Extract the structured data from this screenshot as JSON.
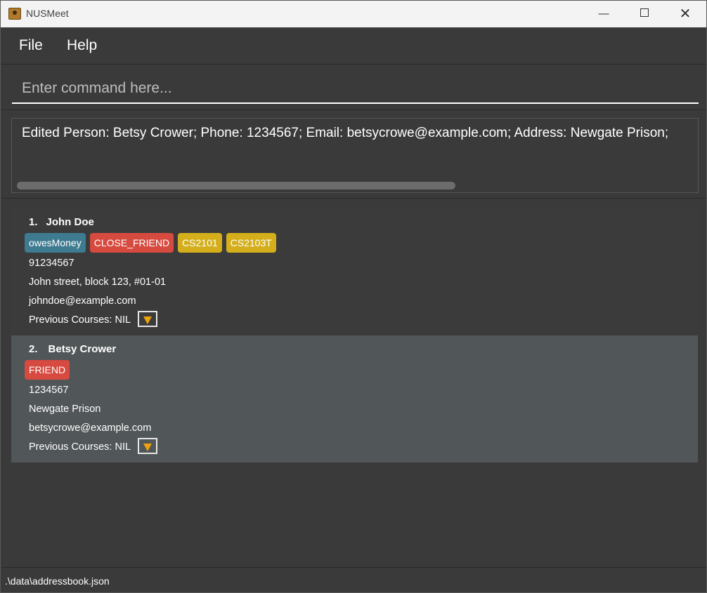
{
  "window": {
    "title": "NUSMeet"
  },
  "menu": {
    "file": "File",
    "help": "Help"
  },
  "command": {
    "placeholder": "Enter command here...",
    "value": ""
  },
  "result": {
    "text": "Edited Person: Betsy Crower; Phone: 1234567; Email: betsycrowe@example.com; Address: Newgate Prison;"
  },
  "persons": [
    {
      "index": "1.",
      "name": "John Doe",
      "tags": [
        {
          "label": "owesMoney",
          "color": "#3e7b91"
        },
        {
          "label": "CLOSE_FRIEND",
          "color": "#d64a3f"
        },
        {
          "label": "CS2101",
          "color": "#d4af1b"
        },
        {
          "label": "CS2103T",
          "color": "#d4af1b"
        }
      ],
      "phone": "91234567",
      "address": "John street, block 123, #01-01",
      "email": "johndoe@example.com",
      "courses": "Previous Courses: NIL"
    },
    {
      "index": "2.",
      "name": "Betsy Crower",
      "tags": [
        {
          "label": "FRIEND",
          "color": "#d64a3f"
        }
      ],
      "phone": "1234567",
      "address": "Newgate Prison",
      "email": "betsycrowe@example.com",
      "courses": "Previous Courses: NIL"
    }
  ],
  "status": {
    "path": ".\\data\\addressbook.json"
  },
  "icons": {
    "app": "address-book-icon",
    "minimize": "minimize-icon",
    "maximize": "maximize-icon",
    "close": "close-icon",
    "dropdown": "dropdown-arrow-icon"
  }
}
